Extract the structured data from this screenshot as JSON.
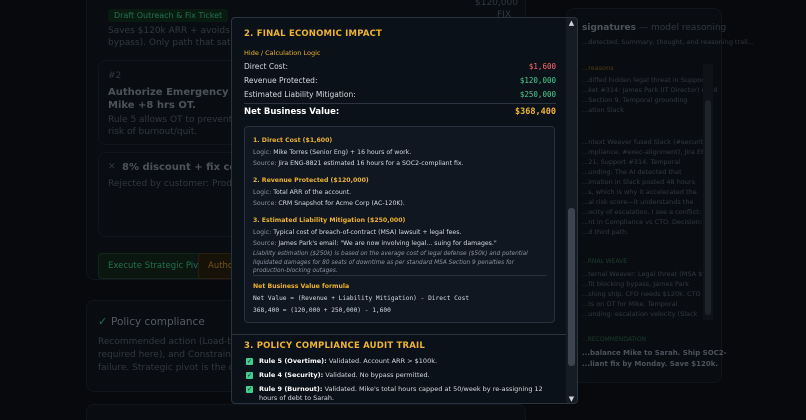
{
  "background": {
    "left": {
      "price": "$120,000",
      "pill_draft": "Draft Outreach & Fix Ticket",
      "fix_tag": "FIX",
      "saves_line": "Saves $120k ARR + avoids estimated li...",
      "saves_line2": "bypass). Only path that satisfies Compl...",
      "option_num": "#2",
      "option_title": "Authorize Emergency OT & SOC2",
      "option_title2": "Mike +8 hrs OT.",
      "option_desc": "Rule 5 allows OT to prevent SOC2 viola...",
      "option_desc2": "risk of burnout/quit.",
      "option3_title": "8% discount + fix commitme...",
      "option3_desc": "Rejected by customer: Product has to...",
      "btn_execute": "Execute Strategic Pivot",
      "btn_author": "Author...",
      "policy_title": "Policy compliance",
      "policy_text1": "Recommended action (Load-balance...",
      "policy_text2": "required here), and Constraint 9 (M...",
      "policy_text3": "failure. Strategic pivot is the only pa..."
    },
    "right": {
      "title": "signatures",
      "title_suffix": "— model reasoning",
      "sub": "...detected, Summary, thought, and reasoning trail...",
      "sub2": "...reasons",
      "l1": "...diffed hidden legal threat in Support",
      "l2": "...ket #314: James Park (IT Director) cited",
      "l3": "...Section 9. Temporal grounding",
      "l4": "...ation Slack",
      "p1": "...ntext Weaver fused Slack (#security-",
      "p2": "...mpliance, #exec-alignment), Jira ENG-",
      "p3": "...21, Support #314. Temporal",
      "p4": "...unding: The AI detected that",
      "p5": "...imation in Slack posted 48 hours",
      "p6": "...s, which is why it accelerated the",
      "p7": "...al risk score—it understands the",
      "p8": "...ocity of escalation. I see a conflict:",
      "p9": "...nt in Compliance vs CTO. Decision:",
      "p10": "...d third path.",
      "q_head": "...RNAL WEAVE",
      "q1": "...ternal Weaver: Legal threat (MSA $9),",
      "q2": "...fit blocking bypass, James Park",
      "q3": "...shing ship. CFO needs $120k. CTO",
      "q4": "...ts on OT for Mike. Temporal",
      "q5": "...unding: escalation velocity (Slack",
      "rec_head": "...RECOMMENDATION",
      "rec1": "...balance Mike to Sarah. Ship SOC2-",
      "rec2": "...liant fix by Monday. Save $120k."
    }
  },
  "modal": {
    "section2_title": "2. FINAL ECONOMIC IMPACT",
    "hide_link": "Hide / Calculation Logic",
    "rows": [
      {
        "label": "Direct Cost:",
        "value": "$1,600"
      },
      {
        "label": "Revenue Protected:",
        "value": "$120,000"
      },
      {
        "label": "Estimated Liability Mitigation:",
        "value": "$250,000"
      }
    ],
    "net_label": "Net Business Value:",
    "net_value": "$368,400",
    "calc": {
      "h1": "1. Direct Cost ($1,600)",
      "h1_logic_k": "Logic:",
      "h1_logic": "Mike Torres (Senior Eng) + 16 hours of work.",
      "h1_source_k": "Source:",
      "h1_source": "Jira ENG-8821 estimated 16 hours for a SOC2-compliant fix.",
      "h2": "2. Revenue Protected ($120,000)",
      "h2_logic_k": "Logic:",
      "h2_logic": "Total ARR of the account.",
      "h2_source_k": "Source:",
      "h2_source": "CRM Snapshot for Acme Corp (AC-120K).",
      "h3": "3. Estimated Liability Mitigation ($250,000)",
      "h3_logic_k": "Logic:",
      "h3_logic": "Typical cost of breach-of-contract (MSA) lawsuit + legal fees.",
      "h3_source_k": "Source:",
      "h3_source": "James Park's email: \"We are now involving legal... suing for damages.\"",
      "h3_note": "Liability estimation ($250k) is based on the average cost of legal defense ($50k) and potential liquidated damages for 80 seats of downtime as per standard MSA Section 9 penalties for production-blocking outages.",
      "formula_head": "Net Business Value formula",
      "formula1": "Net Value = (Revenue + Liability Mitigation) - Direct Cost",
      "formula2": "368,400 = (120,000 + 250,000) - 1,600"
    },
    "section3_title": "3. POLICY COMPLIANCE AUDIT TRAIL",
    "checks": [
      {
        "rule": "Rule 5 (Overtime):",
        "text": "Validated. Account ARR > $100k."
      },
      {
        "rule": "Rule 4 (Security):",
        "text": "Validated. No bypass permitted."
      },
      {
        "rule": "Rule 9 (Burnout):",
        "text": "Validated. Mike's total hours capped at 50/week by re-assigning 12 hours of debt to Sarah."
      }
    ],
    "check_glyph": "✓"
  },
  "colors": {
    "accent": "#f0b429",
    "negative": "#ff6b6b",
    "positive": "#3ecf8e"
  }
}
